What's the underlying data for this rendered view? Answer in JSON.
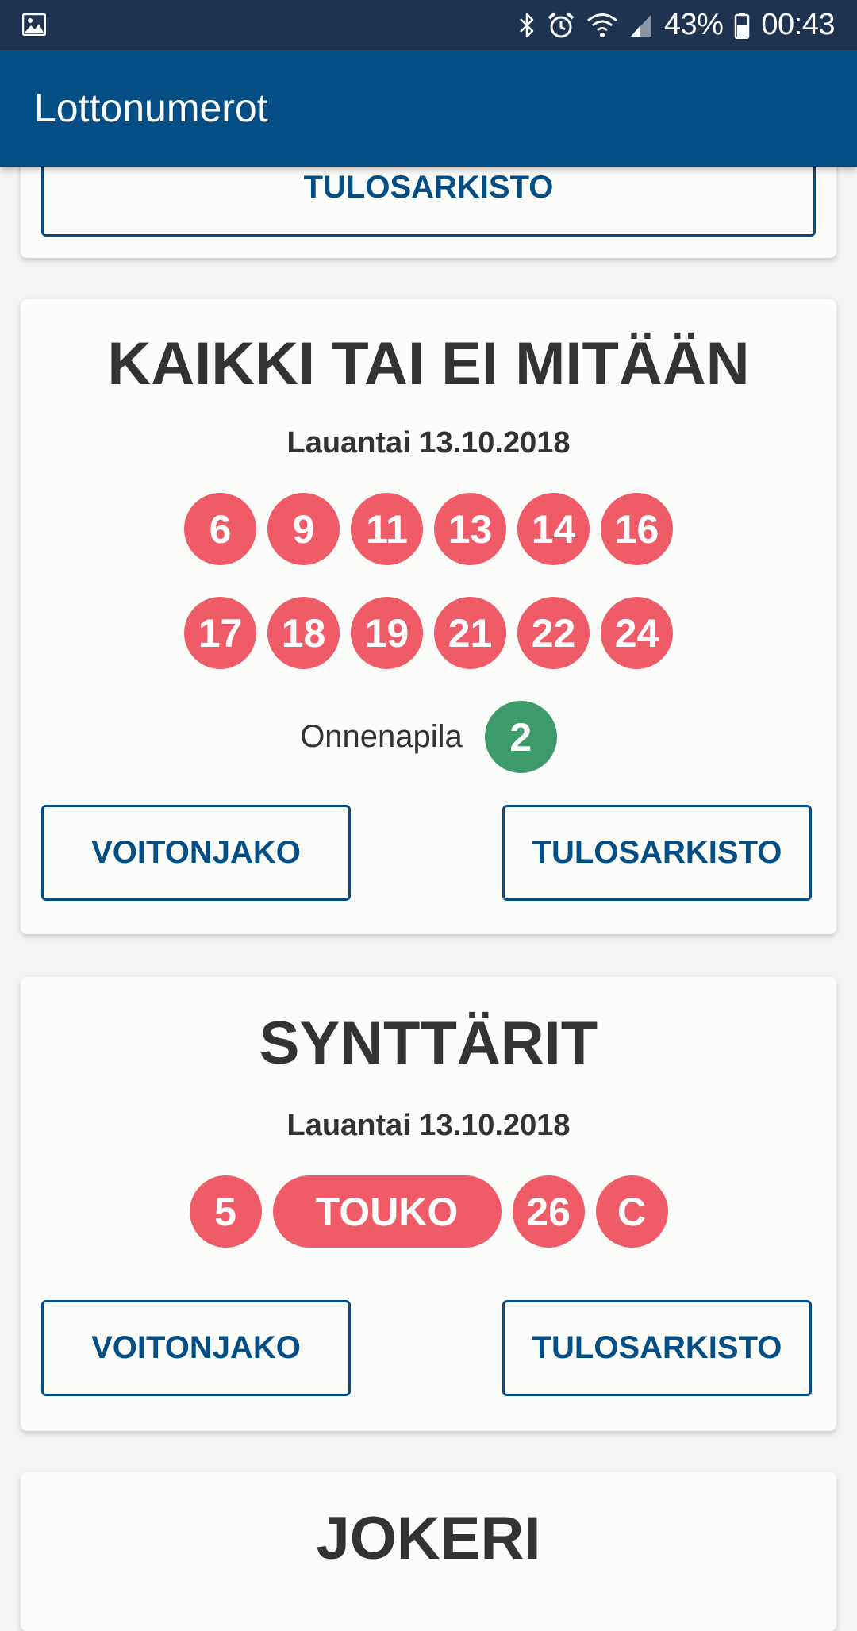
{
  "status_bar": {
    "battery": "43%",
    "time": "00:43",
    "icons": [
      "gallery-icon",
      "bluetooth-icon",
      "alarm-icon",
      "wifi-icon",
      "signal-icon",
      "battery-icon"
    ]
  },
  "app_bar": {
    "title": "Lottonumerot"
  },
  "previous_card": {
    "button_label": "TULOSARKISTO"
  },
  "kaikki": {
    "title": "KAIKKI TAI EI MITÄÄN",
    "date": "Lauantai 13.10.2018",
    "numbers_row1": [
      "6",
      "9",
      "11",
      "13",
      "14",
      "16"
    ],
    "numbers_row2": [
      "17",
      "18",
      "19",
      "21",
      "22",
      "24"
    ],
    "extra_label": "Onnenapila",
    "extra_value": "2",
    "left_button": "VOITONJAKO",
    "right_button": "TULOSARKISTO"
  },
  "synttarit": {
    "title": "SYNTTÄRIT",
    "date": "Lauantai 13.10.2018",
    "day": "5",
    "month": "TOUKO",
    "number": "26",
    "letter": "C",
    "left_button": "VOITONJAKO",
    "right_button": "TULOSARKISTO"
  },
  "jokeri": {
    "title": "JOKERI"
  },
  "colors": {
    "status_bar": "#1d3350",
    "app_bar": "#034f85",
    "ball_red": "#ef5b66",
    "ball_green": "#3d9c6a",
    "button_text": "#034f85"
  }
}
